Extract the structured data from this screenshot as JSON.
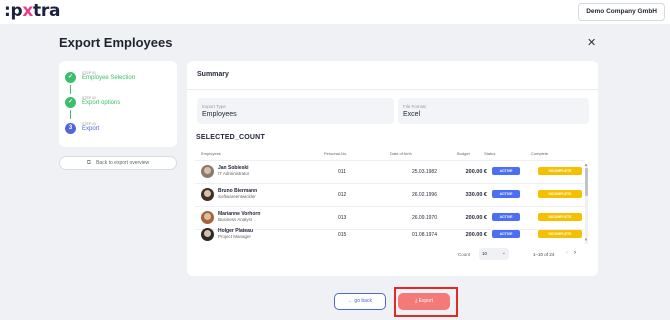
{
  "header": {
    "logo_prefix": ":p",
    "logo_x": "x",
    "logo_suffix": "tra",
    "company": "Demo Company GmbH"
  },
  "page": {
    "title": "Export Employees",
    "close_icon": "close-icon"
  },
  "stepper": {
    "steps": [
      {
        "num": "STEP 01",
        "label": "Employee Selection",
        "state": "done",
        "glyph": "✓"
      },
      {
        "num": "STEP 02",
        "label": "Export options",
        "state": "done",
        "glyph": "✓"
      },
      {
        "num": "STEP 03",
        "label": "Export",
        "state": "active",
        "glyph": "3"
      }
    ],
    "back_label": "Back to export overview"
  },
  "summary": {
    "title": "Summary",
    "export_type_label": "Export Type",
    "export_type_value": "Employees",
    "file_format_label": "File Format",
    "file_format_value": "Excel",
    "count_title": "SELECTED_COUNT",
    "columns": [
      "Employees",
      "Personal-No.",
      "Date of birth",
      "Budget",
      "Status",
      "Complete"
    ],
    "rows": [
      {
        "name": "Jan Sobieski",
        "role": "IT Administrator",
        "pnr": "011",
        "dob": "25.03.1982",
        "budget": "200.00 €",
        "status": "ACTIVE",
        "complete": "INCOMPLETE"
      },
      {
        "name": "Bruno Biermann",
        "role": "Softwareentwickler",
        "pnr": "012",
        "dob": "26.02.1996",
        "budget": "330.00 €",
        "status": "ACTIVE",
        "complete": "INCOMPLETE"
      },
      {
        "name": "Marianne Vorhorn",
        "role": "Business Analyst",
        "pnr": "013",
        "dob": "26.09.1970",
        "budget": "200.00 €",
        "status": "ACTIVE",
        "complete": "INCOMPLETE"
      },
      {
        "name": "Holger Plateau",
        "role": "Project Manager",
        "pnr": "015",
        "dob": "01.08.1974",
        "budget": "200.00 €",
        "status": "ACTIVE",
        "complete": "INCOMPLETE"
      }
    ],
    "pagination": {
      "count_label": "Count",
      "count_value": "10",
      "range": "1–10 of 24"
    }
  },
  "footer": {
    "go_back_label": "← go back",
    "export_label": "⤓ Export"
  },
  "colors": {
    "brand_pink": "#ee3d8a",
    "success_green": "#3bbf6a",
    "primary_blue": "#5266d6",
    "status_blue": "#4c6ef5",
    "incomplete_yellow": "#f6c000",
    "export_red": "#f47a7a",
    "highlight_red": "#e02a2a"
  }
}
